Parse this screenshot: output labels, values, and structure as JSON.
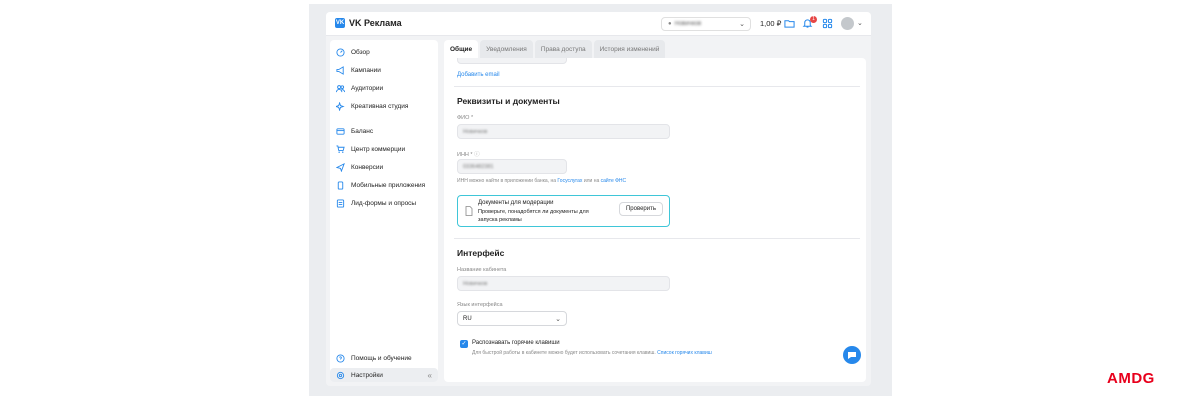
{
  "app": {
    "name": "VK Реклама",
    "logo_text": "VK"
  },
  "topbar": {
    "account_name": "Новичков",
    "balance": "1,00 ₽",
    "notifications_count": "1"
  },
  "sidebar": {
    "items": [
      {
        "label": "Обзор",
        "icon": "overview-icon"
      },
      {
        "label": "Кампании",
        "icon": "megaphone-icon"
      },
      {
        "label": "Аудитории",
        "icon": "users-icon"
      },
      {
        "label": "Креативная студия",
        "icon": "sparkle-icon"
      },
      {
        "label": "Баланс",
        "icon": "wallet-icon"
      },
      {
        "label": "Центр коммерции",
        "icon": "cart-icon"
      },
      {
        "label": "Конверсии",
        "icon": "send-icon"
      },
      {
        "label": "Мобильные приложения",
        "icon": "phone-icon"
      },
      {
        "label": "Лид-формы и опросы",
        "icon": "form-icon"
      }
    ],
    "bottom_items": [
      {
        "label": "Помощь и обучение",
        "icon": "help-icon"
      },
      {
        "label": "Настройки",
        "icon": "settings-icon"
      }
    ],
    "collapse_glyph": "«"
  },
  "tabs": [
    {
      "label": "Общие",
      "active": true
    },
    {
      "label": "Уведомления",
      "active": false
    },
    {
      "label": "Права доступа",
      "active": false
    },
    {
      "label": "История изменений",
      "active": false
    }
  ],
  "general": {
    "add_email_link": "Добавить email",
    "requisites_title": "Реквизиты и документы",
    "fio_label": "ФИО *",
    "fio_value": "Новичков",
    "inn_label": "ИНН *",
    "inn_value": "0336482381",
    "inn_hint_prefix": "ИНН можно найти в приложении банка, на",
    "inn_hint_link1": "Госуслугах",
    "inn_hint_mid": "или на",
    "inn_hint_link2": "сайте ФНС",
    "docs": {
      "title": "Документы для модерации",
      "text": "Проверьте, понадобятся ли документы для запуска рекламы",
      "button": "Проверить"
    },
    "interface_title": "Интерфейс",
    "cabinet_label": "Название кабинета",
    "cabinet_value": "Новичков",
    "language_label": "Язык интерфейса",
    "language_value": "RU",
    "hotkeys_label": "Распознавать горячие клавиши",
    "hotkeys_checked": true,
    "hotkeys_hint": "Для быстрой работы в кабинете можно будет использовать сочетания клавиш.",
    "hotkeys_link": "Список горячих клавиш"
  },
  "watermark": "AMDG",
  "colors": {
    "accent": "#2688eb",
    "highlight_border": "#3fc6d8",
    "watermark": "#e8001c"
  }
}
